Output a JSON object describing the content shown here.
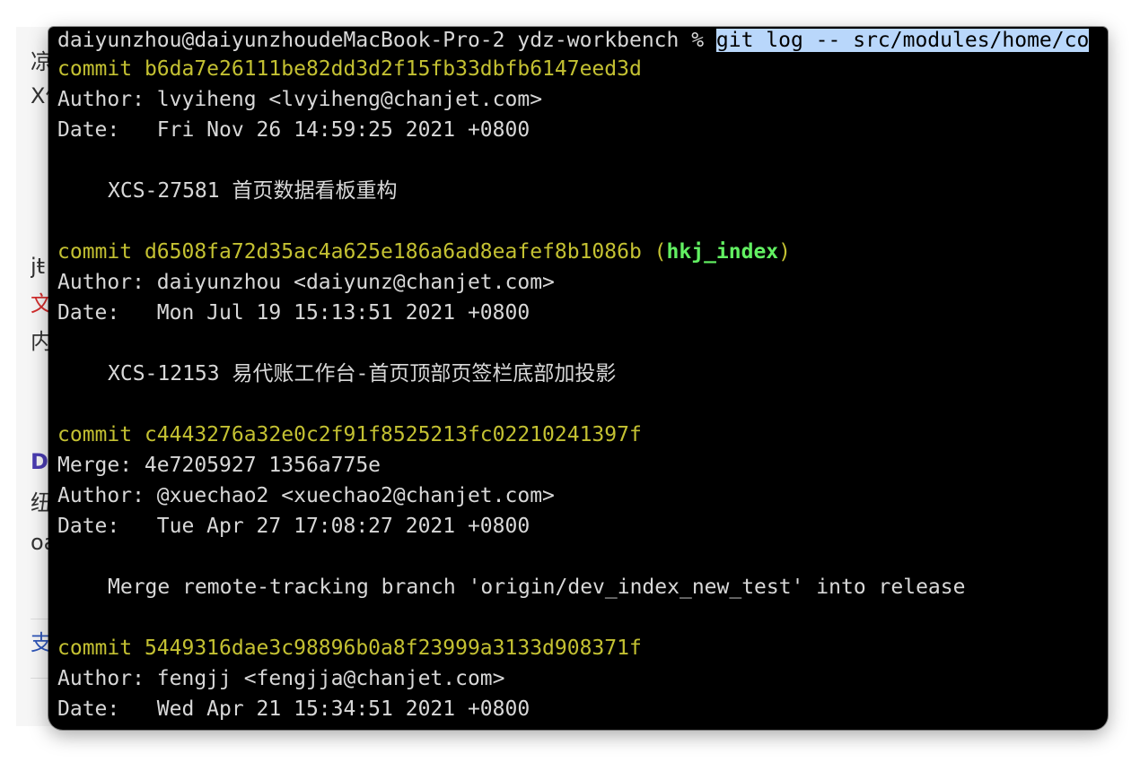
{
  "background": {
    "fragments": [
      "凉",
      "X份",
      "jŧ",
      "文",
      "内",
      "DN",
      "纽",
      "oa",
      "支"
    ]
  },
  "terminal": {
    "prompt": "daiyunzhou@daiyunzhoudeMacBook-Pro-2 ydz-workbench % ",
    "command": "git log -- src/modules/home/co",
    "commits": [
      {
        "commit_label": "commit ",
        "hash": "b6da7e26111be82dd3d2f15fb33dbfb6147eed3d",
        "author": "Author: lvyiheng <lvyiheng@chanjet.com>",
        "date": "Date:   Fri Nov 26 14:59:25 2021 +0800",
        "message": "XCS-27581 首页数据看板重构"
      },
      {
        "commit_label": "commit ",
        "hash": "d6508fa72d35ac4a625e186a6ad8eafef8b1086b",
        "ref_open": " (",
        "ref": "hkj_index",
        "ref_close": ")",
        "author": "Author: daiyunzhou <daiyunz@chanjet.com>",
        "date": "Date:   Mon Jul 19 15:13:51 2021 +0800",
        "message": "XCS-12153 易代账工作台-首页顶部页签栏底部加投影"
      },
      {
        "commit_label": "commit ",
        "hash": "c4443276a32e0c2f91f8525213fc02210241397f",
        "merge": "Merge: 4e7205927 1356a775e",
        "author": "Author: @xuechao2 <xuechao2@chanjet.com>",
        "date": "Date:   Tue Apr 27 17:08:27 2021 +0800",
        "message": "Merge remote-tracking branch 'origin/dev_index_new_test' into release"
      },
      {
        "commit_label": "commit ",
        "hash": "5449316dae3c98896b0a8f23999a3133d908371f",
        "author": "Author: fengjj <fengjja@chanjet.com>",
        "date": "Date:   Wed Apr 21 15:34:51 2021 +0800"
      }
    ]
  },
  "colors": {
    "terminal_bg": "#000000",
    "text": "#d8d8d8",
    "commit_yellow": "#c4c132",
    "branch_green": "#62f062",
    "selection": "#b9d7fb"
  }
}
